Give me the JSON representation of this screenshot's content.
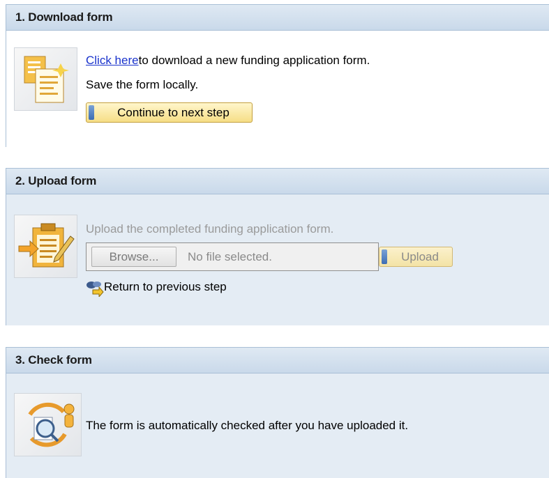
{
  "step1": {
    "title": "1. Download form",
    "icon": "document-download-icon",
    "link_text": "Click here",
    "description_rest": "to download a new funding application form.",
    "save_text": "Save the form locally.",
    "continue_label": "Continue to next step"
  },
  "step2": {
    "title": "2. Upload form",
    "icon": "clipboard-edit-icon",
    "instruction": "Upload the completed funding application form.",
    "browse_label": "Browse...",
    "no_file_text": "No file selected.",
    "upload_label": "Upload",
    "return_label": "Return to previous step",
    "return_icon": "return-arrow-icon"
  },
  "step3": {
    "title": "3. Check form",
    "icon": "magnifier-check-icon",
    "description": "The form is automatically checked after you have uploaded it."
  },
  "colors": {
    "header_bg": "#c9d9ea",
    "panel_border": "#a9bfd6",
    "disabled_body_bg": "#e4ecf4",
    "link": "#1a33cc",
    "button_bg": "#f6de86"
  }
}
